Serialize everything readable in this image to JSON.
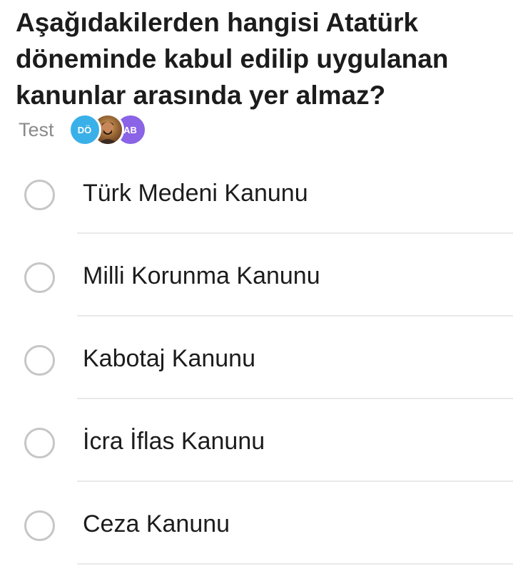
{
  "question": {
    "text": "Aşağıdakilerden hangisi Atatürk döneminde kabul edilip uygulanan kanunlar arasında yer almaz?"
  },
  "meta": {
    "label": "Test",
    "avatars": [
      {
        "initials": "DÖ",
        "color": "#3ab0e8"
      },
      {
        "initials": "",
        "kind": "photo"
      },
      {
        "initials": "AB",
        "color": "#8a63e6"
      }
    ]
  },
  "options": [
    {
      "label": "Türk Medeni Kanunu",
      "selected": false
    },
    {
      "label": "Milli Korunma Kanunu",
      "selected": false
    },
    {
      "label": "Kabotaj Kanunu",
      "selected": false
    },
    {
      "label": "İcra İflas Kanunu",
      "selected": false
    },
    {
      "label": "Ceza Kanunu",
      "selected": false
    }
  ]
}
